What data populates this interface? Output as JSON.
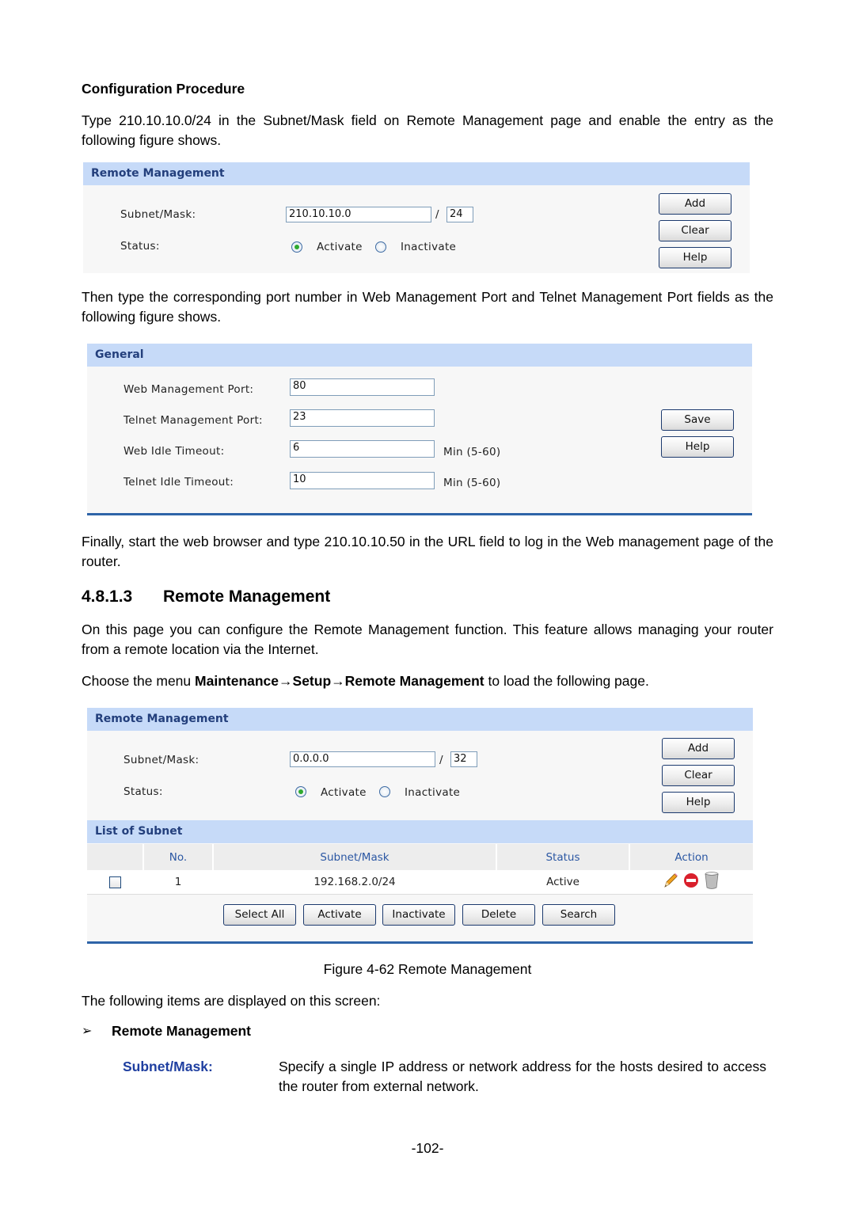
{
  "config_procedure": {
    "heading": "Configuration Procedure",
    "para1": "Type 210.10.10.0/24 in the Subnet/Mask field on Remote Management page and enable the entry as the following figure shows."
  },
  "figure1": {
    "title": "Remote Management",
    "subnet_label": "Subnet/Mask:",
    "subnet_value": "210.10.10.0",
    "slash": "/",
    "mask_value": "24",
    "status_label": "Status:",
    "activate_label": "Activate",
    "inactivate_label": "Inactivate",
    "status_selected": "Activate",
    "buttons": {
      "add": "Add",
      "clear": "Clear",
      "help": "Help"
    }
  },
  "para2": "Then type the corresponding port number in Web Management Port and Telnet Management Port fields as the following figure shows.",
  "figure2": {
    "title": "General",
    "fields": [
      {
        "label": "Web Management Port:",
        "value": "80",
        "suffix": ""
      },
      {
        "label": "Telnet Management Port:",
        "value": "23",
        "suffix": ""
      },
      {
        "label": "Web Idle Timeout:",
        "value": "6",
        "suffix": "Min (5-60)"
      },
      {
        "label": "Telnet Idle Timeout:",
        "value": "10",
        "suffix": "Min (5-60)"
      }
    ],
    "buttons": {
      "save": "Save",
      "help": "Help"
    }
  },
  "para3": "Finally, start the web browser and type 210.10.10.50 in the URL field to log in the Web management page of the router.",
  "section": {
    "number": "4.8.1.3",
    "title": "Remote Management",
    "intro": "On this page you can configure the Remote Management function. This feature allows managing your router from a remote location via the Internet.",
    "menu_prefix": "Choose the menu ",
    "menu_path": "Maintenance→Setup→Remote Management",
    "menu_suffix": " to load the following page."
  },
  "figure3": {
    "title": "Remote Management",
    "subnet_label": "Subnet/Mask:",
    "subnet_value": "0.0.0.0",
    "slash": "/",
    "mask_value": "32",
    "status_label": "Status:",
    "activate_label": "Activate",
    "inactivate_label": "Inactivate",
    "status_selected": "Activate",
    "buttons": {
      "add": "Add",
      "clear": "Clear",
      "help": "Help"
    },
    "list_title": "List of Subnet",
    "columns": [
      "",
      "No.",
      "Subnet/Mask",
      "Status",
      "Action"
    ],
    "rows": [
      {
        "checked": false,
        "no": "1",
        "subnet": "192.168.2.0/24",
        "status": "Active",
        "actions": [
          "edit-pencil-icon",
          "disable-icon",
          "delete-trash-icon"
        ]
      }
    ],
    "list_buttons": {
      "select_all": "Select All",
      "activate": "Activate",
      "inactivate": "Inactivate",
      "delete": "Delete",
      "search": "Search"
    },
    "caption": "Figure 4-62 Remote Management"
  },
  "items_intro": "The following items are displayed on this screen:",
  "bullet": {
    "icon": "arrow-bullet-icon",
    "glyph": "➢",
    "title": "Remote Management"
  },
  "definitions": [
    {
      "term": "Subnet/Mask:",
      "desc": "Specify a single IP address or network address for the hosts desired to access the router from external network."
    }
  ],
  "page_number": "-102-",
  "colors": {
    "panel_header": "#c6daf8",
    "panel_title": "#233f7c",
    "term": "#1f3fa0",
    "bottom_rule": "#2e64a8"
  }
}
